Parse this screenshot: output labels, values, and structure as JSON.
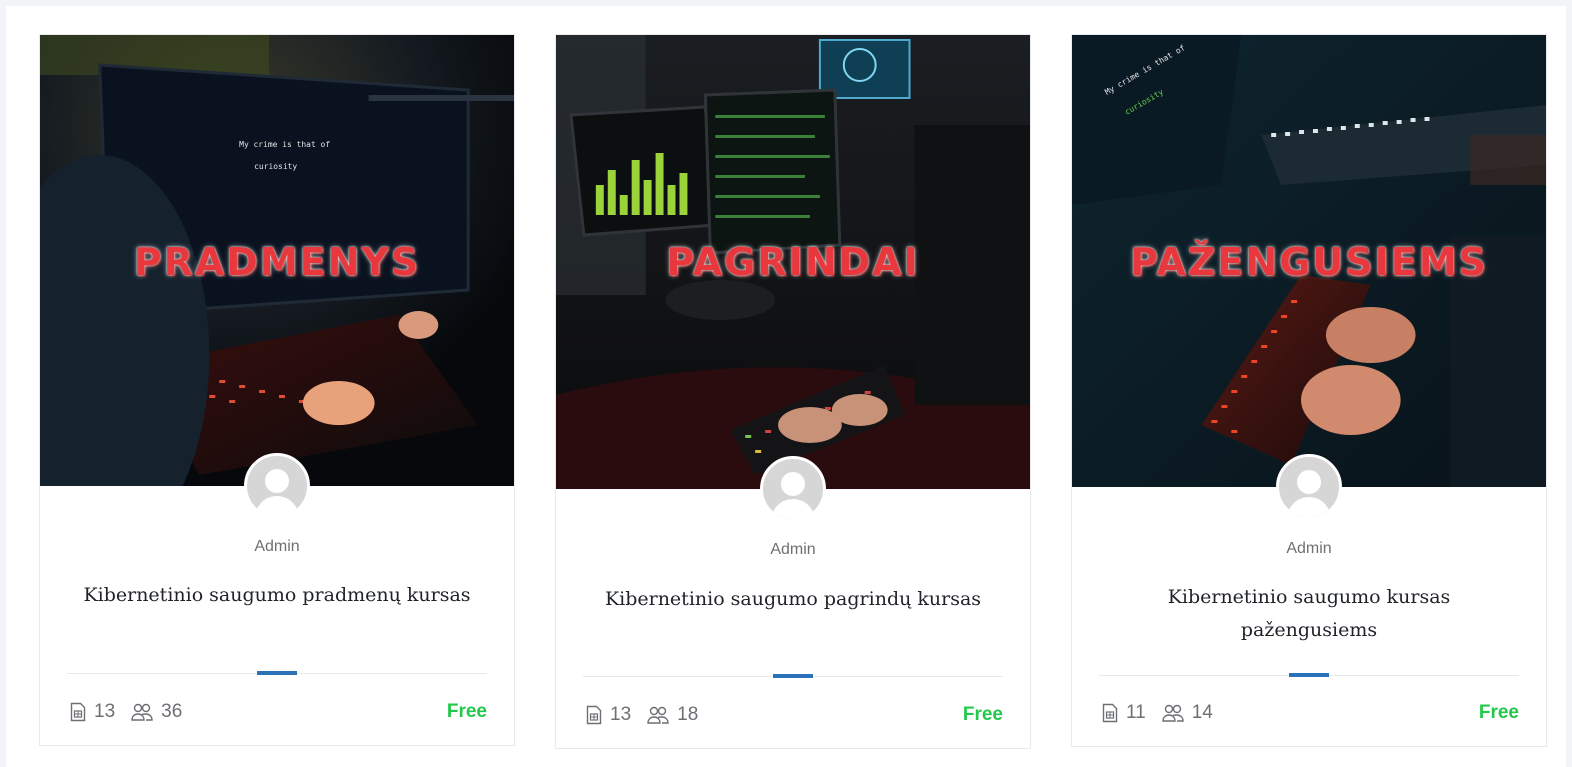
{
  "courses": [
    {
      "thumbnail_title": "PRADMENYS",
      "screen_text_line1": "My crime is that of",
      "screen_text_line2": "curiosity",
      "author": "Admin",
      "title": "Kibernetinio saugumo pradmenų kursas",
      "lessons": "13",
      "students": "36",
      "price": "Free"
    },
    {
      "thumbnail_title": "PAGRINDAI",
      "author": "Admin",
      "title": "Kibernetinio saugumo pagrindų kursas",
      "lessons": "13",
      "students": "18",
      "price": "Free"
    },
    {
      "thumbnail_title": "PAŽENGUSIEMS",
      "screen_text_line1": "My crime is that of",
      "screen_text_line2": "curiosity",
      "author": "Admin",
      "title": "Kibernetinio saugumo kursas pažengusiems",
      "lessons": "11",
      "students": "14",
      "price": "Free"
    }
  ],
  "icons": {
    "lessons": "document-icon",
    "students": "users-icon"
  },
  "colors": {
    "price_free": "#21c84a",
    "accent": "#2c72b8",
    "thumbnail_title": "#e8383d"
  }
}
